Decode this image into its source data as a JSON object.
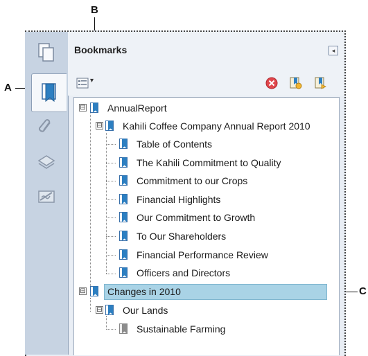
{
  "callouts": {
    "a": "A",
    "b": "B",
    "c": "C"
  },
  "panel": {
    "title": "Bookmarks",
    "collapse_glyph": "◂",
    "options_arrow": "▾"
  },
  "tree": [
    {
      "id": "annual-report",
      "label": "AnnualReport",
      "toggle": "⊟"
    },
    {
      "id": "kahili-report",
      "label": "Kahili Coffee Company Annual Report 2010",
      "toggle": "⊟"
    },
    {
      "id": "toc",
      "label": "Table of Contents"
    },
    {
      "id": "commitment-quality",
      "label": "The Kahili Commitment to Quality"
    },
    {
      "id": "commitment-crops",
      "label": "Commitment to our Crops"
    },
    {
      "id": "financial-highlights",
      "label": "Financial Highlights"
    },
    {
      "id": "commitment-growth",
      "label": "Our Commitment to Growth"
    },
    {
      "id": "shareholders",
      "label": "To Our Shareholders"
    },
    {
      "id": "financial-performance",
      "label": "Financial Performance Review"
    },
    {
      "id": "officers",
      "label": "Officers and Directors"
    },
    {
      "id": "changes-2010",
      "label": "Changes in 2010",
      "toggle": "⊟",
      "selected": true
    },
    {
      "id": "our-lands",
      "label": "Our Lands",
      "toggle": "⊟"
    },
    {
      "id": "sustainable-farming",
      "label": "Sustainable Farming"
    }
  ],
  "colors": {
    "selection": "#a9d3e6",
    "bookmark_blue": "#2d7fc1",
    "delete_red": "#e0474c"
  }
}
